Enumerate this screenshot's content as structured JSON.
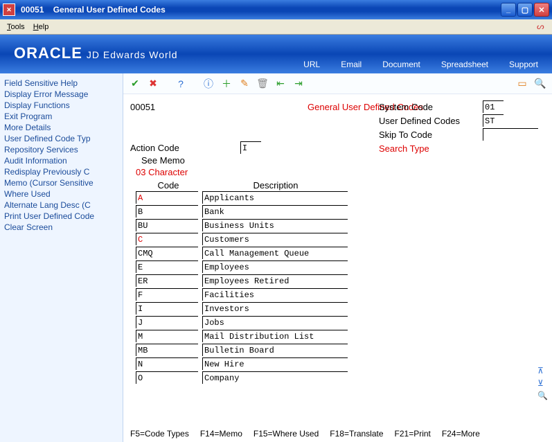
{
  "window": {
    "id": "00051",
    "title": "General User Defined Codes"
  },
  "menubar": {
    "tools": "Tools",
    "help": "Help"
  },
  "banner": {
    "logo": "ORACLE",
    "logo_sub": "JD Edwards World",
    "links": {
      "url": "URL",
      "email": "Email",
      "document": "Document",
      "spreadsheet": "Spreadsheet",
      "support": "Support"
    }
  },
  "sidebar": {
    "items": [
      "Field Sensitive Help",
      "Display Error Message",
      "Display Functions",
      "Exit Program",
      "More Details",
      "User Defined Code Typ",
      "Repository Services",
      "Audit Information",
      "Redisplay Previously C",
      "Memo (Cursor Sensitive",
      "Where Used",
      "Alternate Lang Desc (C",
      "Print User Defined Code",
      "Clear Screen"
    ]
  },
  "form": {
    "screen_id": "00051",
    "title": "General User Defined Codes",
    "labels": {
      "system_code": "System Code",
      "user_defined_codes": "User Defined Codes",
      "skip_to_code": "Skip To Code",
      "search_type": "Search Type",
      "action_code": "Action Code",
      "see_memo": "See Memo",
      "char_line": "03 Character",
      "code": "Code",
      "description": "Description"
    },
    "values": {
      "system_code": "01",
      "user_defined_codes": "ST",
      "action_code": "I",
      "skip_to_code": ""
    },
    "rows": [
      {
        "code": "A",
        "code_red": true,
        "desc": "Applicants"
      },
      {
        "code": "B",
        "code_red": false,
        "desc": "Bank"
      },
      {
        "code": "BU",
        "code_red": false,
        "desc": "Business Units"
      },
      {
        "code": "C",
        "code_red": true,
        "desc": "Customers"
      },
      {
        "code": "CMQ",
        "code_red": false,
        "desc": "Call Management Queue"
      },
      {
        "code": "E",
        "code_red": false,
        "desc": "Employees"
      },
      {
        "code": "ER",
        "code_red": false,
        "desc": "Employees Retired"
      },
      {
        "code": "F",
        "code_red": false,
        "desc": "Facilities"
      },
      {
        "code": "I",
        "code_red": false,
        "desc": "Investors"
      },
      {
        "code": "J",
        "code_red": false,
        "desc": "Jobs"
      },
      {
        "code": "M",
        "code_red": false,
        "desc": "Mail Distribution List"
      },
      {
        "code": "MB",
        "code_red": false,
        "desc": "Bulletin Board"
      },
      {
        "code": "N",
        "code_red": false,
        "desc": "New Hire"
      },
      {
        "code": "O",
        "code_red": false,
        "desc": "Company"
      }
    ]
  },
  "footer": {
    "items": [
      "F5=Code Types",
      "F14=Memo",
      "F15=Where Used",
      "F18=Translate",
      "F21=Print",
      "F24=More"
    ]
  }
}
